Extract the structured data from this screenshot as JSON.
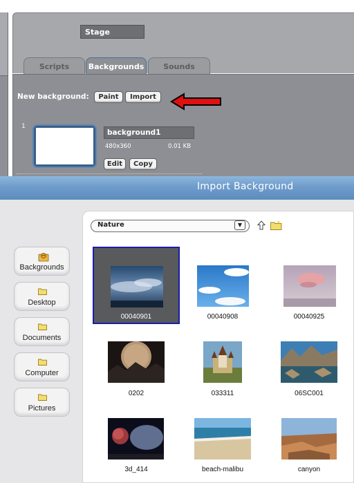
{
  "stage": {
    "name": "Stage"
  },
  "tabs": [
    {
      "label": "Scripts",
      "active": false
    },
    {
      "label": "Backgrounds",
      "active": true
    },
    {
      "label": "Sounds",
      "active": false
    }
  ],
  "backgrounds_panel": {
    "new_label": "New background:",
    "paint_label": "Paint",
    "import_label": "Import",
    "costume": {
      "index": "1",
      "name": "background1",
      "size": "480x360",
      "kb": "0.01 KB",
      "edit_label": "Edit",
      "copy_label": "Copy"
    }
  },
  "dialog": {
    "title": "Import Background",
    "places": [
      {
        "label": "Backgrounds",
        "icon": "scratch-cat-icon"
      },
      {
        "label": "Desktop",
        "icon": "folder-icon"
      },
      {
        "label": "Documents",
        "icon": "folder-icon"
      },
      {
        "label": "Computer",
        "icon": "folder-icon"
      },
      {
        "label": "Pictures",
        "icon": "folder-icon"
      }
    ],
    "folder": {
      "selected": "Nature"
    },
    "files": [
      {
        "name": "00040901",
        "selected": true
      },
      {
        "name": "00040908",
        "selected": false
      },
      {
        "name": "00040925",
        "selected": false
      },
      {
        "name": "0202",
        "selected": false
      },
      {
        "name": "033311",
        "selected": false
      },
      {
        "name": "06SC001",
        "selected": false
      },
      {
        "name": "3d_414",
        "selected": false
      },
      {
        "name": "beach-malibu",
        "selected": false
      },
      {
        "name": "canyon",
        "selected": false
      }
    ]
  },
  "colors": {
    "panel_gray": "#8d8f94",
    "dialog_title_blue": "#6f9ccb",
    "selection_border": "#1c1ca8",
    "arrow_red": "#e01010"
  }
}
